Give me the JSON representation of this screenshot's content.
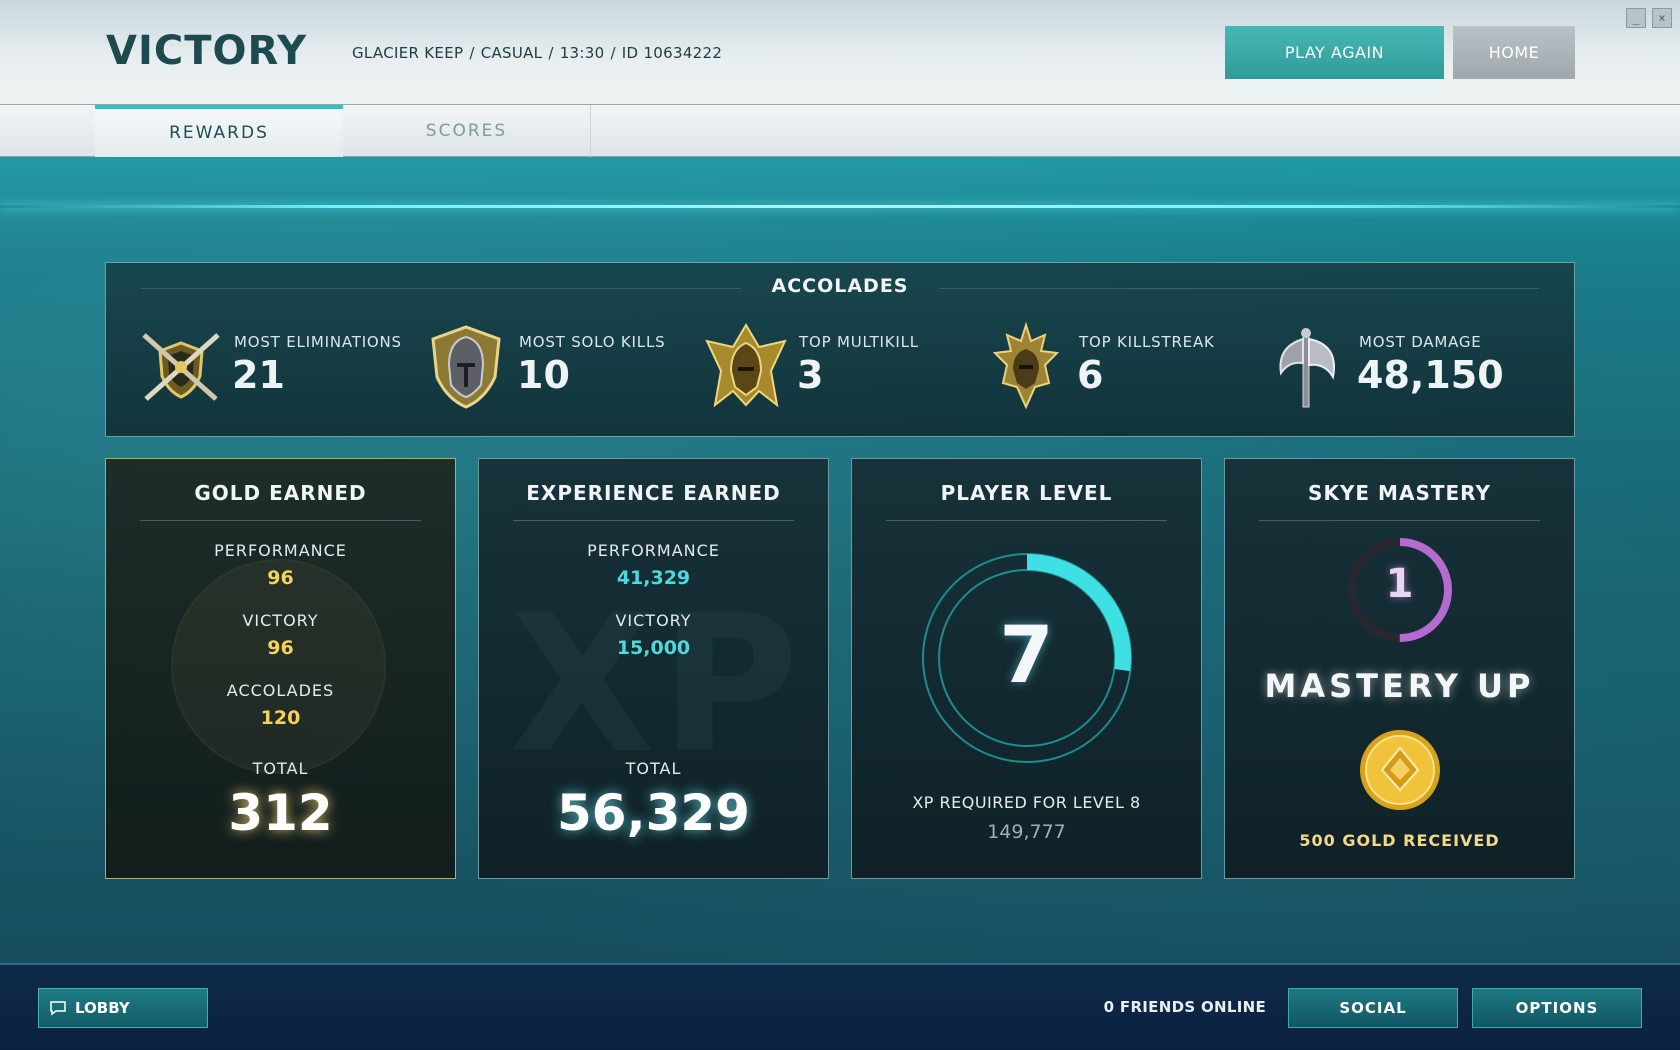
{
  "header": {
    "title": "VICTORY",
    "map": "GLACIER KEEP",
    "mode": "CASUAL",
    "duration": "13:30",
    "match_id": "ID 10634222",
    "separator": "/",
    "play_again_label": "PLAY AGAIN",
    "home_label": "HOME",
    "minimize_glyph": "_",
    "close_glyph": "×"
  },
  "tabs": [
    {
      "label": "REWARDS",
      "active": true
    },
    {
      "label": "SCORES",
      "active": false
    }
  ],
  "accolades": {
    "title": "ACCOLADES",
    "items": [
      {
        "label": "MOST ELIMINATIONS",
        "value": "21",
        "icon": "crossed-swords-shield-icon"
      },
      {
        "label": "MOST SOLO KILLS",
        "value": "10",
        "icon": "knight-helmet-shield-icon"
      },
      {
        "label": "TOP MULTIKILL",
        "value": "3",
        "icon": "golden-warrior-helmet-icon"
      },
      {
        "label": "TOP KILLSTREAK",
        "value": "6",
        "icon": "spiked-helmet-icon"
      },
      {
        "label": "MOST DAMAGE",
        "value": "48,150",
        "icon": "battle-axe-icon"
      }
    ]
  },
  "gold": {
    "title": "GOLD EARNED",
    "rows": [
      {
        "label": "PERFORMANCE",
        "value": "96"
      },
      {
        "label": "VICTORY",
        "value": "96"
      },
      {
        "label": "ACCOLADES",
        "value": "120"
      }
    ],
    "total_label": "TOTAL",
    "total": "312",
    "accent": "#f5d35a"
  },
  "experience": {
    "title": "EXPERIENCE EARNED",
    "watermark": "XP",
    "rows": [
      {
        "label": "PERFORMANCE",
        "value": "41,329"
      },
      {
        "label": "VICTORY",
        "value": "15,000"
      }
    ],
    "total_label": "TOTAL",
    "total": "56,329",
    "accent": "#4fd8dd"
  },
  "player_level": {
    "title": "PLAYER LEVEL",
    "level": "7",
    "progress": 0.27,
    "requirement_label": "XP REQUIRED FOR LEVEL 8",
    "requirement_value": "149,777",
    "accent": "#3fe0e4"
  },
  "mastery": {
    "title": "SKYE MASTERY",
    "level": "1",
    "progress": 0.5,
    "banner": "MASTERY UP",
    "reward": "500 GOLD RECEIVED",
    "accent": "#b56ad0"
  },
  "footer": {
    "lobby_label": "LOBBY",
    "friends_online": "0 FRIENDS ONLINE",
    "social_label": "SOCIAL",
    "options_label": "OPTIONS"
  }
}
